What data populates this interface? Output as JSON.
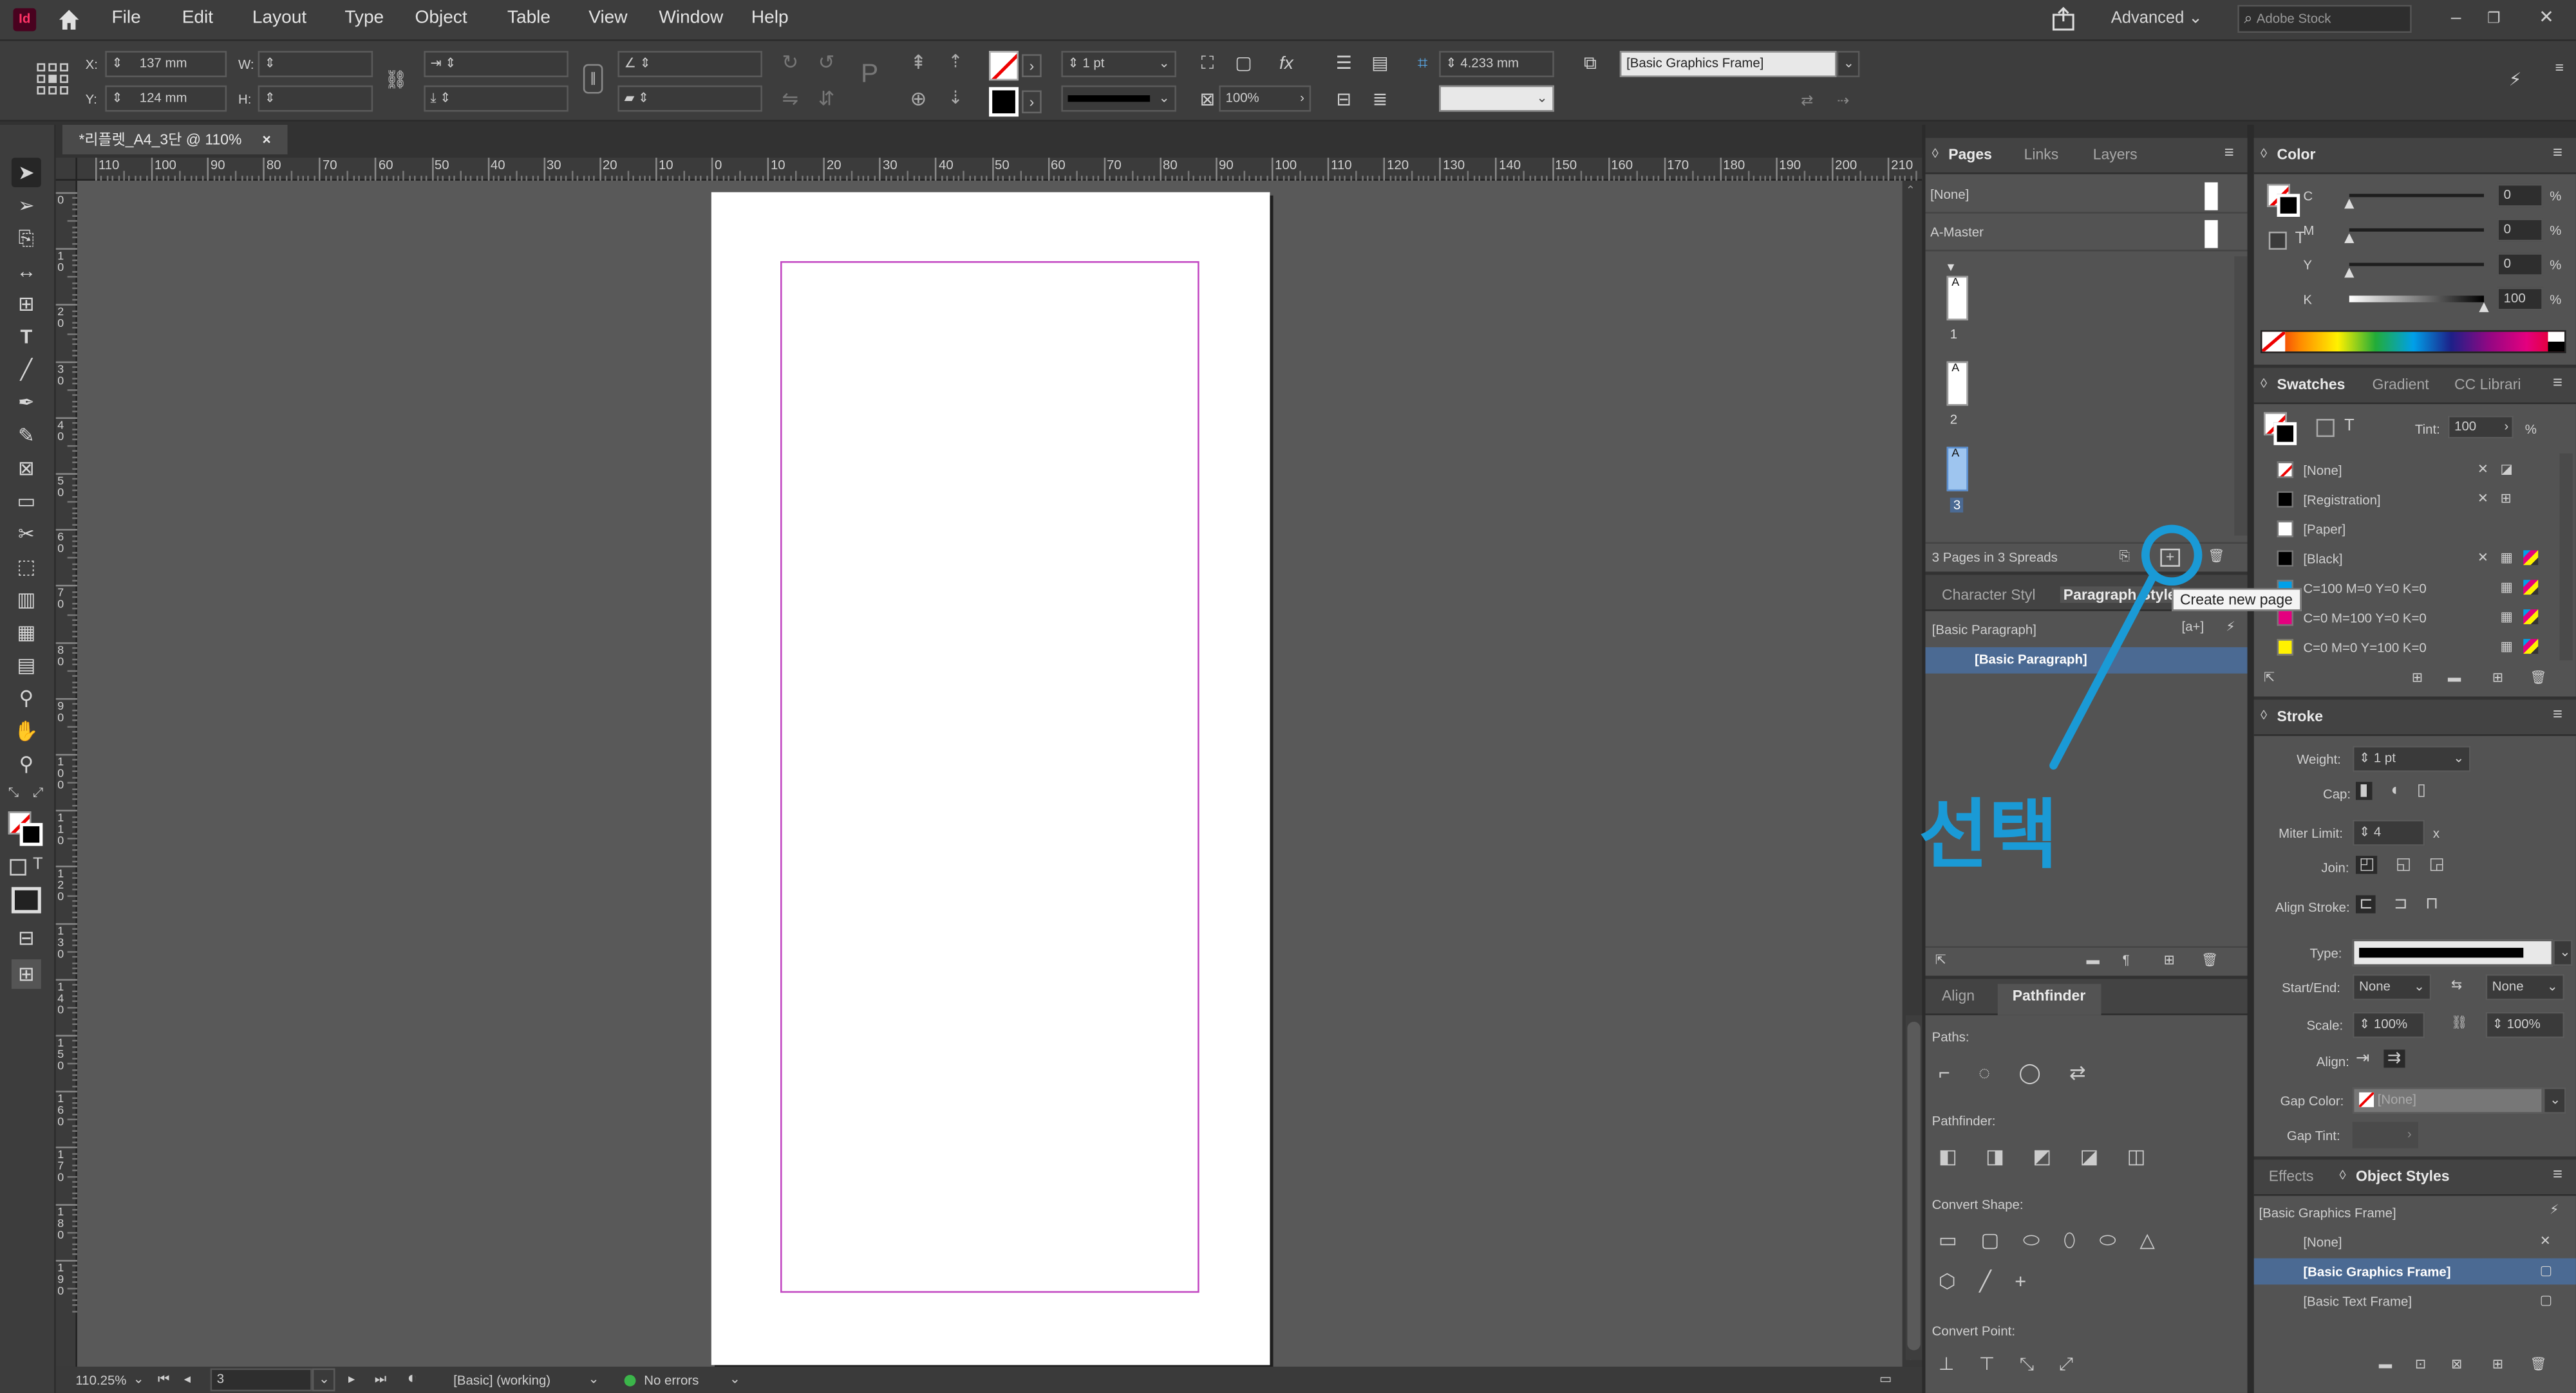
{
  "menubar": {
    "app_icon": "Id",
    "items": [
      "File",
      "Edit",
      "Layout",
      "Type",
      "Object",
      "Table",
      "View",
      "Window",
      "Help"
    ],
    "workspace": "Advanced",
    "search_placeholder": "Adobe Stock"
  },
  "control": {
    "x_label": "X:",
    "x_value": "137 mm",
    "y_label": "Y:",
    "y_value": "124 mm",
    "w_label": "W:",
    "h_label": "H:",
    "stroke_weight": "1 pt",
    "offset_value": "4.233 mm",
    "scale_value": "100%",
    "object_style": "[Basic Graphics Frame]"
  },
  "document": {
    "tab_title": "*리플렛_A4_3단 @ 110%",
    "close_symbol": "×"
  },
  "ruler": {
    "labels": [
      "110",
      "100",
      "90",
      "80",
      "70",
      "60",
      "50",
      "40",
      "30",
      "20",
      "10",
      "0",
      "10",
      "20",
      "30",
      "40",
      "50",
      "60",
      "70",
      "80",
      "90",
      "100",
      "110",
      "120",
      "130",
      "140",
      "150",
      "160",
      "170",
      "180",
      "190",
      "200",
      "210"
    ]
  },
  "vruler": {
    "labels": [
      "0",
      "1 0",
      "2 0",
      "3 0",
      "4 0",
      "5 0",
      "6 0",
      "7 0",
      "8 0",
      "9 0",
      "1 0 0",
      "1 1 0",
      "1 2 0",
      "1 3 0",
      "1 4 0",
      "1 5 0",
      "1 6 0",
      "1 7 0",
      "1 8 0",
      "1 9 0"
    ]
  },
  "status": {
    "zoom": "110.25%",
    "page": "3",
    "preflight_profile": "[Basic] (working)",
    "errors": "No errors"
  },
  "pages_panel": {
    "tabs": [
      "Pages",
      "Links",
      "Layers"
    ],
    "masters": [
      "[None]",
      "A-Master"
    ],
    "pages": [
      {
        "label": "1",
        "master": "A",
        "selected": false
      },
      {
        "label": "2",
        "master": "A",
        "selected": false
      },
      {
        "label": "3",
        "master": "A",
        "selected": true
      }
    ],
    "footer": "3 Pages in 3 Spreads",
    "tooltip": "Create new page",
    "annotation": "선택"
  },
  "styles_panel": {
    "tabs": [
      "Character Styl",
      "Paragraph Style"
    ],
    "current": "[Basic Paragraph]",
    "items": [
      "[Basic Paragraph]"
    ]
  },
  "pathfinder_panel": {
    "tabs": [
      "Align",
      "Pathfinder"
    ],
    "sections": [
      "Paths:",
      "Pathfinder:",
      "Convert Shape:",
      "Convert Point:"
    ]
  },
  "color_panel": {
    "title": "Color",
    "channels": [
      {
        "name": "C",
        "value": "0"
      },
      {
        "name": "M",
        "value": "0"
      },
      {
        "name": "Y",
        "value": "0"
      },
      {
        "name": "K",
        "value": "100"
      }
    ],
    "unit": "%"
  },
  "swatches_panel": {
    "tabs": [
      "Swatches",
      "Gradient",
      "CC Librari"
    ],
    "tint_label": "Tint:",
    "tint_value": "100",
    "unit": "%",
    "items": [
      {
        "name": "[None]",
        "color": "#ffffff"
      },
      {
        "name": "[Registration]",
        "color": "#000000"
      },
      {
        "name": "[Paper]",
        "color": "#ffffff"
      },
      {
        "name": "[Black]",
        "color": "#000000"
      },
      {
        "name": "C=100 M=0 Y=0 K=0",
        "color": "#00a0e9"
      },
      {
        "name": "C=0 M=100 Y=0 K=0",
        "color": "#e4007f"
      },
      {
        "name": "C=0 M=0 Y=100 K=0",
        "color": "#fff100"
      }
    ]
  },
  "stroke_panel": {
    "title": "Stroke",
    "weight_label": "Weight:",
    "weight_value": "1 pt",
    "cap_label": "Cap:",
    "miter_label": "Miter Limit:",
    "miter_value": "4",
    "miter_unit": "x",
    "join_label": "Join:",
    "align_stroke_label": "Align Stroke:",
    "type_label": "Type:",
    "startend_label": "Start/End:",
    "start_value": "None",
    "end_value": "None",
    "scale_label": "Scale:",
    "scale_start": "100%",
    "scale_end": "100%",
    "align_label": "Align:",
    "gap_color_label": "Gap Color:",
    "gap_color_value": "[None]",
    "gap_tint_label": "Gap Tint:"
  },
  "object_styles_panel": {
    "tabs": [
      "Effects",
      "Object Styles"
    ],
    "current": "[Basic Graphics Frame]",
    "items": [
      {
        "name": "[None]",
        "selected": false
      },
      {
        "name": "[Basic Graphics Frame]",
        "selected": true
      },
      {
        "name": "[Basic Text Frame]",
        "selected": false
      }
    ]
  },
  "colors": {
    "accent_annotation": "#1a9ad6",
    "margin_guide": "#c247c2",
    "selection": "#4b6a93",
    "status_ok": "#3bb54a"
  }
}
